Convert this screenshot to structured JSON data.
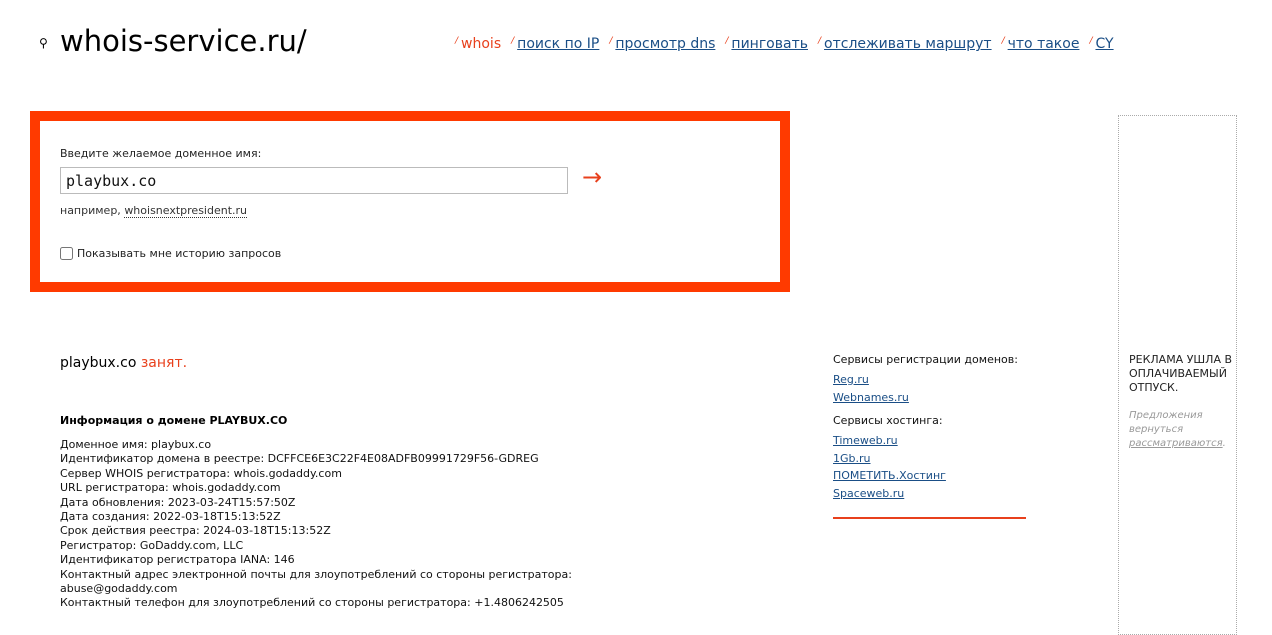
{
  "header": {
    "logo_text": "whois-service.ru/",
    "logo_icon": "search-icon",
    "nav": [
      {
        "label": "whois",
        "active": true
      },
      {
        "label": "поиск по IP",
        "active": false
      },
      {
        "label": "просмотр dns",
        "active": false
      },
      {
        "label": "пинговать",
        "active": false
      },
      {
        "label": "отслеживать маршрут",
        "active": false
      },
      {
        "label": "что такое",
        "active": false
      },
      {
        "label": "CY",
        "active": false
      }
    ],
    "nav_separator": "/"
  },
  "search": {
    "label": "Введите желаемое доменное имя:",
    "value": "playbux.co",
    "go_arrow": "→",
    "example_prefix": "например,",
    "example_link": "whoisnextpresident.ru",
    "history_label": "Показывать мне историю запросов",
    "history_checked": false
  },
  "result": {
    "domain": "playbux.co",
    "status": "занят.",
    "info_title": "Информация о домене PLAYBUX.CO",
    "lines": [
      "Доменное имя: playbux.co",
      "Идентификатор домена в реестре: DCFFCE6E3C22F4E08ADFB09991729F56-GDREG",
      "Сервер WHOIS регистратора: whois.godaddy.com",
      "URL регистратора: whois.godaddy.com",
      "Дата обновления: 2023-03-24T15:57:50Z",
      "Дата создания: 2022-03-18T15:13:52Z",
      "Срок действия реестра: 2024-03-18T15:13:52Z",
      "Регистратор: GoDaddy.com, LLC",
      "Идентификатор регистратора IANA: 146",
      "Контактный адрес электронной почты для злоупотреблений со стороны регистратора:",
      "abuse@godaddy.com",
      "Контактный телефон для злоупотреблений со стороны регистратора: +1.4806242505"
    ]
  },
  "services": {
    "registration_heading": "Сервисы регистрации доменов:",
    "registration_links": [
      "Reg.ru",
      "Webnames.ru"
    ],
    "hosting_heading": "Сервисы хостинга:",
    "hosting_links": [
      "Timeweb.ru",
      "1Gb.ru",
      "ПОМЕТИТЬ.Хостинг",
      "Spaceweb.ru"
    ]
  },
  "ad": {
    "title": "РЕКЛАМА УШЛА В ОПЛАЧИВАЕМЫЙ ОТПУСК.",
    "text_prefix": "Предложения вернуться",
    "text_link": "рассматриваются",
    "text_suffix": "."
  },
  "colors": {
    "accent": "#ff3a00",
    "link": "#1a4e86"
  }
}
